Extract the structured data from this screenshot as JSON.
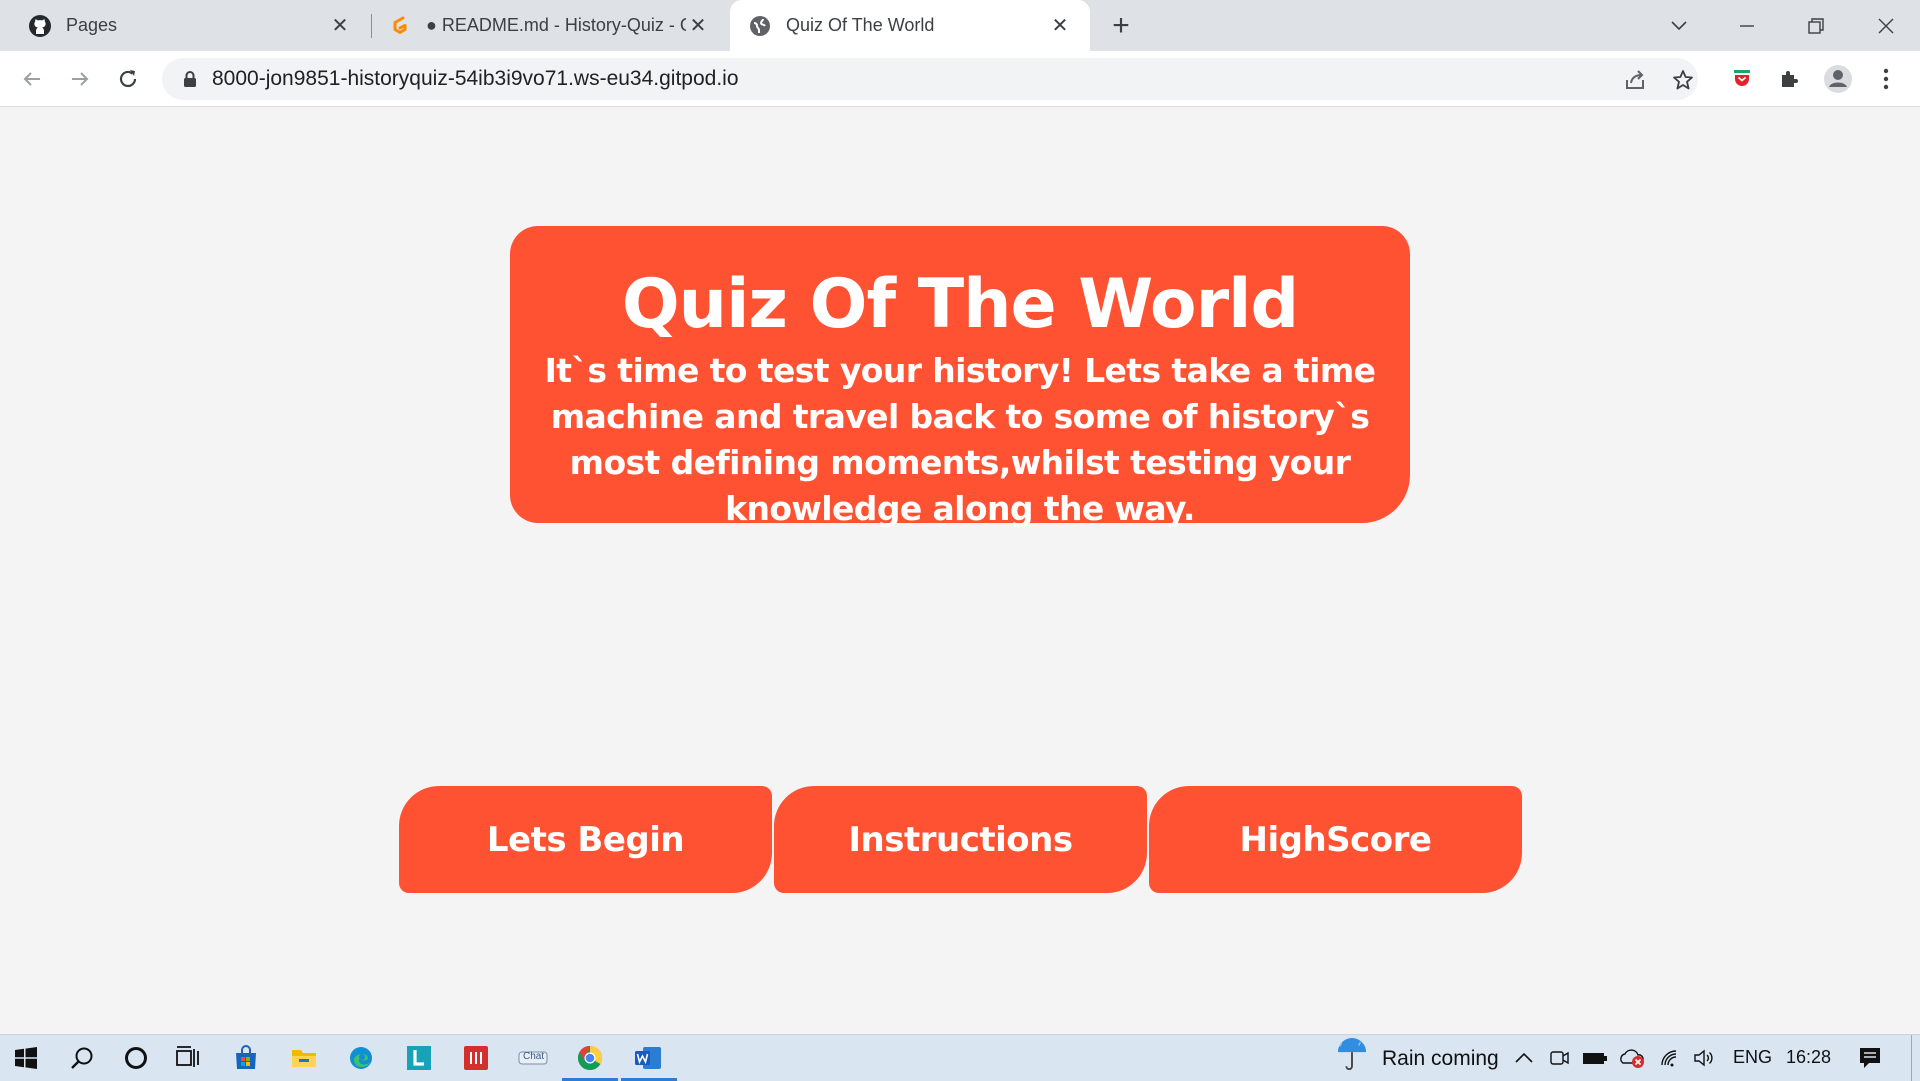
{
  "browser": {
    "tabs": [
      {
        "title": "Pages",
        "icon": "github-icon"
      },
      {
        "title": "● README.md - History-Quiz - G",
        "icon": "gitpod-icon"
      },
      {
        "title": "Quiz Of The World",
        "icon": "globe-icon",
        "active": true
      }
    ],
    "url": "8000-jon9851-historyquiz-54ib3i9vo71.ws-eu34.gitpod.io"
  },
  "hero": {
    "title": "Quiz Of The World",
    "subtitle": "It`s time to test your history! Lets take a time machine and travel back to some of history`s most defining moments,whilst testing your knowledge along the way."
  },
  "buttons": {
    "begin": "Lets Begin",
    "instructions": "Instructions",
    "highscore": "HighScore"
  },
  "taskbar": {
    "weather": "Rain coming",
    "language": "ENG",
    "time": "16:28",
    "chat_label": "Chat"
  },
  "colors": {
    "accent": "#ff5233",
    "page_bg": "#f4f4f4"
  }
}
